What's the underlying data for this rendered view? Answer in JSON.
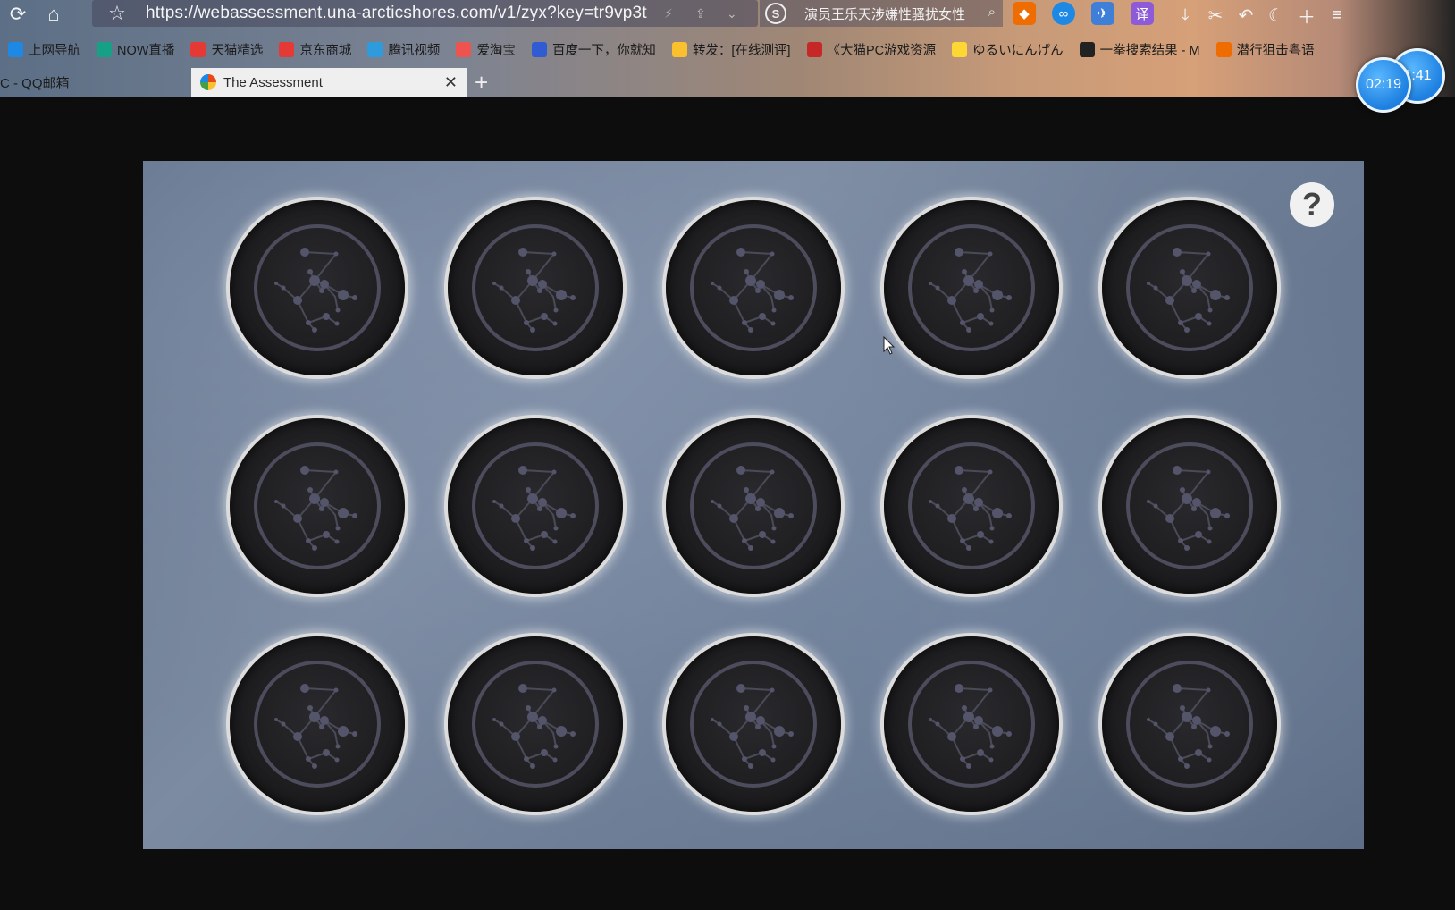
{
  "browser": {
    "url": "https://webassessment.una-arcticshores.com/v1/zyx?key=tr9vp3t",
    "search_text": "演员王乐天涉嫌性骚扰女性",
    "bookmarks": [
      {
        "label": "上网导航",
        "icon": "ie-icon",
        "color": "#1e88e5"
      },
      {
        "label": "NOW直播",
        "icon": "play-icon",
        "color": "#16a085"
      },
      {
        "label": "天猫精选",
        "icon": "tmall-icon",
        "color": "#e53935"
      },
      {
        "label": "京东商城",
        "icon": "jd-icon",
        "color": "#e53935"
      },
      {
        "label": "腾讯视频",
        "icon": "video-icon",
        "color": "#2e9bdc"
      },
      {
        "label": "爱淘宝",
        "icon": "taobao-icon",
        "color": "#ef5350"
      },
      {
        "label": "百度一下，你就知",
        "icon": "baidu-icon",
        "color": "#2f5bd3"
      },
      {
        "label": "转发：[在线测评]",
        "icon": "share-icon",
        "color": "#fbc02d"
      },
      {
        "label": "《大猫PC游戏资源",
        "icon": "game-icon",
        "color": "#c62828"
      },
      {
        "label": "ゆるいにんげん",
        "icon": "cat-icon",
        "color": "#fdd835"
      },
      {
        "label": "一拳搜索结果 - M",
        "icon": "bilibili-icon",
        "color": "#222"
      },
      {
        "label": "潜行狙击粤语",
        "icon": "flag-icon",
        "color": "#ef6c00"
      }
    ],
    "tabs": [
      {
        "label": "C - QQ邮箱",
        "active": false
      },
      {
        "label": "The Assessment",
        "active": true
      }
    ],
    "timers": [
      "02:19",
      "1:41"
    ]
  },
  "game": {
    "help_label": "?",
    "tiles": [
      {
        "id": 1
      },
      {
        "id": 2
      },
      {
        "id": 3
      },
      {
        "id": 4
      },
      {
        "id": 5
      },
      {
        "id": 6
      },
      {
        "id": 7
      },
      {
        "id": 8
      },
      {
        "id": 9
      },
      {
        "id": 10
      },
      {
        "id": 11
      },
      {
        "id": 12
      },
      {
        "id": 13
      },
      {
        "id": 14
      },
      {
        "id": 15
      }
    ]
  }
}
